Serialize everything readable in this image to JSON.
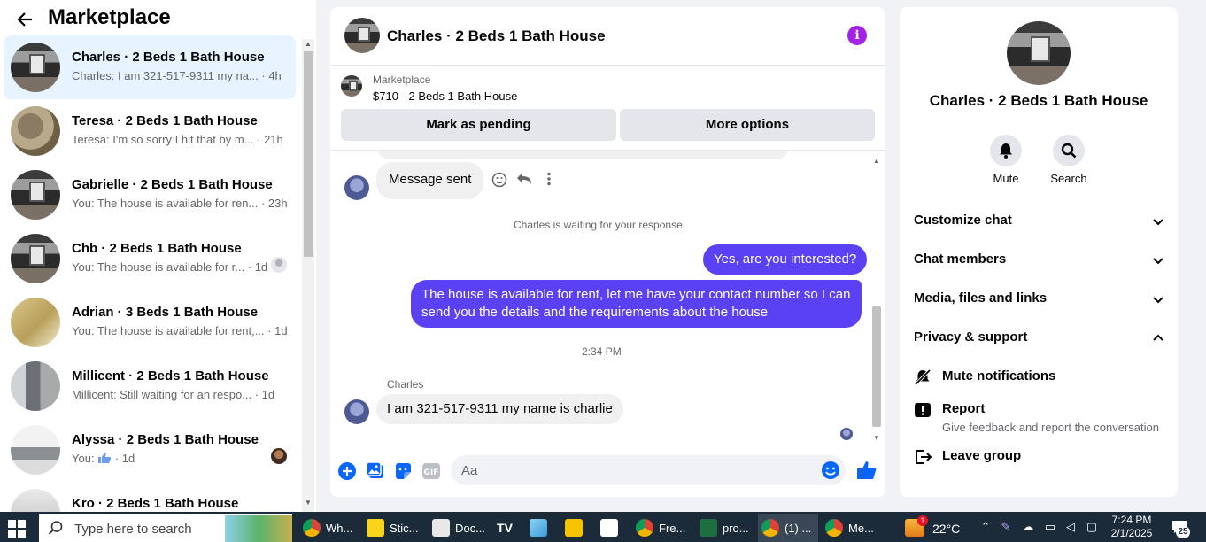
{
  "marketplace": {
    "title": "Marketplace",
    "conversations": [
      {
        "name": "Charles · 2 Beds 1 Bath House",
        "preview": "Charles: I am 321-517-9311 my na...",
        "time": "· 4h"
      },
      {
        "name": "Teresa · 2 Beds 1 Bath House",
        "preview": "Teresa: I'm so sorry I hit that by m...",
        "time": "· 21h"
      },
      {
        "name": "Gabrielle · 2 Beds 1 Bath House",
        "preview": "You: The house is available for ren...",
        "time": "· 23h"
      },
      {
        "name": "Chb · 2 Beds 1 Bath House",
        "preview": "You: The house is available for r...",
        "time": "· 1d"
      },
      {
        "name": "Adrian · 3 Beds 1 Bath House",
        "preview": "You: The house is available for rent,...",
        "time": "· 1d"
      },
      {
        "name": "Millicent · 2 Beds 1 Bath House",
        "preview": "Millicent: Still waiting for an respo...",
        "time": "· 1d"
      },
      {
        "name": "Alyssa · 2 Beds 1 Bath House",
        "preview": "You:",
        "time": "· 1d"
      },
      {
        "name": "Kro · 2 Beds 1 Bath House",
        "preview": "",
        "time": ""
      }
    ]
  },
  "chat": {
    "title": "Charles · 2 Beds 1 Bath House",
    "listing_label": "Marketplace",
    "listing_desc": "$710 - 2 Beds 1 Bath House",
    "mark_pending": "Mark as pending",
    "more_options": "More options",
    "messages": {
      "auto_sent": "Message sent",
      "waiting": "Charles is waiting for your response.",
      "out1": "Yes, are you interested?",
      "out2": "The  house is available for rent, let me have your contact number so I can send you the details and the requirements about the house",
      "time_divider": "2:34 PM",
      "sender": "Charles",
      "in1": "I am 321-517-9311 my name is charlie"
    },
    "input_placeholder": "Aa"
  },
  "details": {
    "name": "Charles · 2 Beds 1 Bath House",
    "mute": "Mute",
    "search": "Search",
    "sections": [
      "Customize chat",
      "Chat members",
      "Media, files and links",
      "Privacy & support"
    ],
    "mute_notifications": "Mute notifications",
    "report": "Report",
    "report_sub": "Give feedback and report the conversation",
    "leave_group": "Leave group"
  },
  "taskbar": {
    "search_placeholder": "Type here to search",
    "apps": [
      "Wh...",
      "Stic...",
      "Doc...",
      "",
      "",
      "",
      "",
      "Fre...",
      "pro...",
      "(1) ...",
      "Me..."
    ],
    "temperature": "22°C",
    "time": "7:24 PM",
    "date": "2/1/2025",
    "notification_count": "25",
    "weather_badge": "1"
  },
  "colors": {
    "accent": "#a323e3",
    "outgoing_bubble": "#5a41f4",
    "messenger_blue": "#0866ff",
    "active_conv": "#e7f3ff"
  }
}
